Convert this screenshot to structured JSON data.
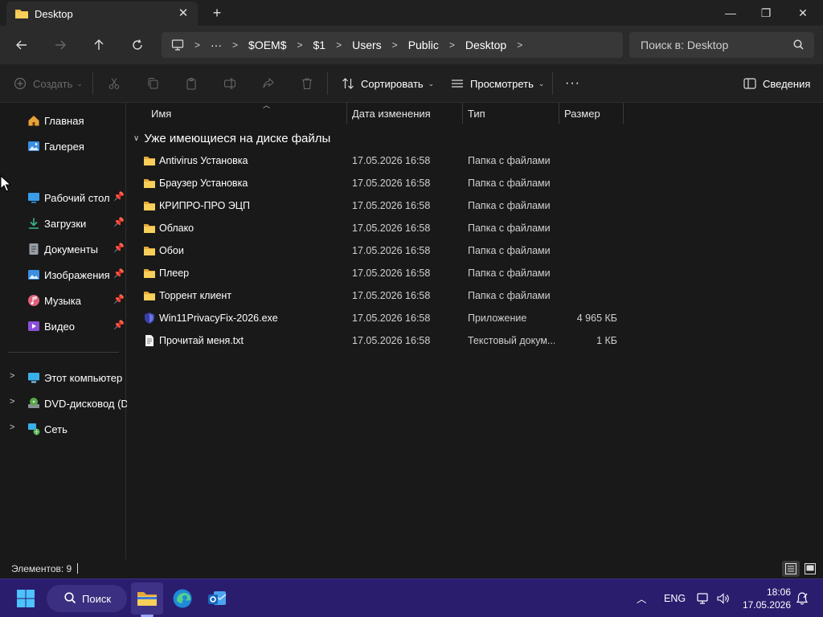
{
  "window": {
    "tab_title": "Desktop",
    "controls": {
      "minimize": "—",
      "maximize": "❐",
      "close": "✕"
    }
  },
  "address": {
    "breadcrumbs": [
      "$OEM$",
      "$1",
      "Users",
      "Public",
      "Desktop"
    ],
    "ellipsis": "···",
    "search_placeholder": "Поиск в: Desktop"
  },
  "commands": {
    "create": "Создать",
    "sort": "Сортировать",
    "view": "Просмотреть",
    "more": "···",
    "details": "Сведения"
  },
  "sidebar": {
    "top": [
      {
        "label": "Главная",
        "icon": "home-icon",
        "color": "#e8a23a"
      },
      {
        "label": "Галерея",
        "icon": "gallery-icon",
        "color": "#3b8ee0"
      }
    ],
    "pinned": [
      {
        "label": "Рабочий стол",
        "icon": "desktop-icon",
        "color": "#3a9be8"
      },
      {
        "label": "Загрузки",
        "icon": "download-icon",
        "color": "#3fb58c"
      },
      {
        "label": "Документы",
        "icon": "documents-icon",
        "color": "#9aa0a8"
      },
      {
        "label": "Изображения",
        "icon": "pictures-icon",
        "color": "#3b8ee0"
      },
      {
        "label": "Музыка",
        "icon": "music-icon",
        "color": "#e0607a"
      },
      {
        "label": "Видео",
        "icon": "video-icon",
        "color": "#8a4fd8"
      }
    ],
    "devices": [
      {
        "label": "Этот компьютер",
        "icon": "computer-icon",
        "color": "#3ab0e8"
      },
      {
        "label": "DVD-дисковод (D:)",
        "icon": "dvd-drive-icon",
        "color": "#5aa84a"
      },
      {
        "label": "Сеть",
        "icon": "network-icon",
        "color": "#3ab0e8"
      }
    ]
  },
  "columns": {
    "name": "Имя",
    "date": "Дата изменения",
    "type": "Тип",
    "size": "Размер"
  },
  "group_title": "Уже имеющиеся на диске файлы",
  "files": [
    {
      "name": "Antivirus Установка",
      "date": "17.05.2026 16:58",
      "type": "Папка с файлами",
      "size": "",
      "icon": "folder-icon"
    },
    {
      "name": "Браузер Установка",
      "date": "17.05.2026 16:58",
      "type": "Папка с файлами",
      "size": "",
      "icon": "folder-icon"
    },
    {
      "name": "КРИПРО-ПРО ЭЦП",
      "date": "17.05.2026 16:58",
      "type": "Папка с файлами",
      "size": "",
      "icon": "folder-icon"
    },
    {
      "name": "Облако",
      "date": "17.05.2026 16:58",
      "type": "Папка с файлами",
      "size": "",
      "icon": "folder-icon"
    },
    {
      "name": "Обои",
      "date": "17.05.2026 16:58",
      "type": "Папка с файлами",
      "size": "",
      "icon": "folder-icon"
    },
    {
      "name": "Плеер",
      "date": "17.05.2026 16:58",
      "type": "Папка с файлами",
      "size": "",
      "icon": "folder-icon"
    },
    {
      "name": "Торрент клиент",
      "date": "17.05.2026 16:58",
      "type": "Папка с файлами",
      "size": "",
      "icon": "folder-icon"
    },
    {
      "name": "Win11PrivacyFix-2026.exe",
      "date": "17.05.2026 16:58",
      "type": "Приложение",
      "size": "4 965 КБ",
      "icon": "shield-app-icon"
    },
    {
      "name": "Прочитай меня.txt",
      "date": "17.05.2026 16:58",
      "type": "Текстовый докум...",
      "size": "1 КБ",
      "icon": "text-file-icon"
    }
  ],
  "status": {
    "items_count": "Элементов: 9"
  },
  "taskbar": {
    "search_label": "Поиск",
    "language": "ENG",
    "time": "18:06",
    "date": "17.05.2026",
    "accent": "#2a1d6e"
  }
}
